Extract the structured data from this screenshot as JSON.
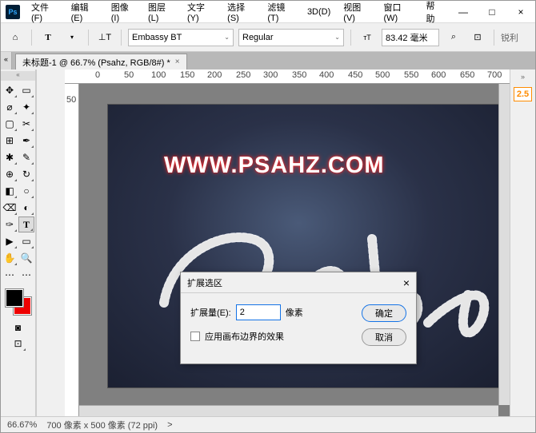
{
  "app": {
    "logo": "Ps"
  },
  "menu": [
    "文件(F)",
    "编辑(E)",
    "图像(I)",
    "图层(L)",
    "文字(Y)",
    "选择(S)",
    "滤镜(T)",
    "3D(D)",
    "视图(V)",
    "窗口(W)",
    "帮助"
  ],
  "winbtns": {
    "min": "—",
    "max": "□",
    "close": "×"
  },
  "options": {
    "font": "Embassy BT",
    "style": "Regular",
    "size": "83.42 毫米",
    "aa": "锐利"
  },
  "tab": {
    "title": "未标题-1 @ 66.7% (Psahz, RGB/8#) *",
    "close": "×"
  },
  "ruler_h": [
    "0",
    "50",
    "100",
    "150",
    "200",
    "250",
    "300",
    "350",
    "400",
    "450",
    "500",
    "550",
    "600",
    "650",
    "700"
  ],
  "ruler_v": [
    "50"
  ],
  "canvas": {
    "watermark": "WWW.PSAHZ.COM",
    "script": "Psahz"
  },
  "right": {
    "value": "2.5"
  },
  "status": {
    "zoom": "66.67%",
    "info": "700 像素 x 500 像素 (72 ppi)",
    "arrow": ">"
  },
  "dialog": {
    "title": "扩展选区",
    "close": "×",
    "expand_label": "扩展量(E):",
    "expand_value": "2",
    "unit": "像素",
    "checkbox_label": "应用画布边界的效果",
    "ok": "确定",
    "cancel": "取消"
  },
  "swatch": {
    "fg": "#000000",
    "bg": "#e00000"
  }
}
